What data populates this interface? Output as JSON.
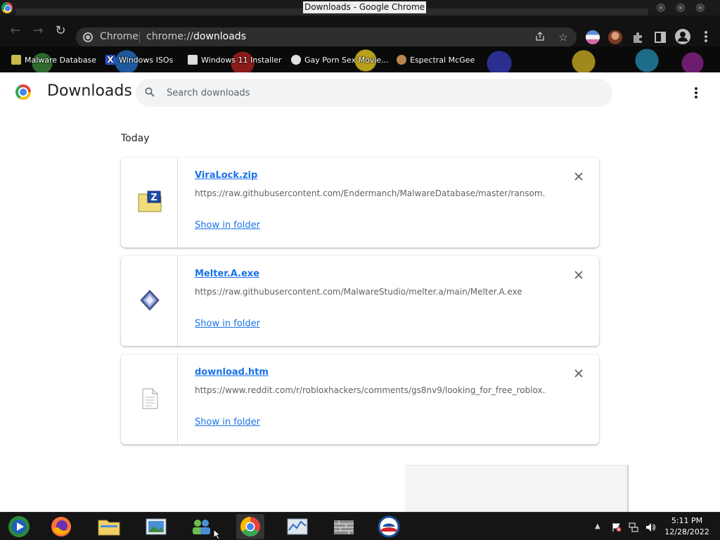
{
  "window": {
    "title": "Downloads - Google Chrome"
  },
  "toolbar": {
    "site_chip": "Chrome",
    "url_scheme": "chrome://",
    "url_host": "downloads"
  },
  "bookmarks": [
    {
      "label": "Malware Database",
      "icon": "pawn-icon",
      "color": "#c9b84a"
    },
    {
      "label": "Windows ISOs",
      "icon": "x-icon",
      "color": "#2f55d4"
    },
    {
      "label": "Windows 11 Installer",
      "icon": "page-icon",
      "color": "#dddddd"
    },
    {
      "label": "Gay Porn Sex Movie...",
      "icon": "skull-icon",
      "color": "#e0e0e0"
    },
    {
      "label": "Espectral McGee",
      "icon": "figure-icon",
      "color": "#b8864b"
    }
  ],
  "header": {
    "title": "Downloads",
    "search_placeholder": "Search downloads"
  },
  "downloads": {
    "date_label": "Today",
    "items": [
      {
        "name": "ViraLock.zip",
        "url": "https://raw.githubusercontent.com/Endermanch/MalwareDatabase/master/ransom...",
        "action": "Show in folder",
        "icon": "zip-folder-icon"
      },
      {
        "name": "Melter.A.exe",
        "url": "https://raw.githubusercontent.com/MalwareStudio/melter.a/main/Melter.A.exe",
        "action": "Show in folder",
        "icon": "exe-diamond-icon"
      },
      {
        "name": "download.htm",
        "url": "https://www.reddit.com/r/robloxhackers/comments/gs8nv9/looking_for_free_roblox...",
        "action": "Show in folder",
        "icon": "document-icon"
      }
    ]
  },
  "taskbar": {
    "apps": [
      "windows-media-center-icon",
      "firefox-icon",
      "file-explorer-icon",
      "photo-viewer-icon",
      "network-people-icon",
      "chrome-icon",
      "task-manager-icon",
      "firewall-icon",
      "obama-logo-icon"
    ],
    "clock_time": "5:11 PM",
    "clock_date": "12/28/2022"
  },
  "colors": {
    "link_blue": "#1a73e8",
    "text_primary": "#202124",
    "text_secondary": "#5f6368",
    "search_bg": "#f1f3f4"
  }
}
